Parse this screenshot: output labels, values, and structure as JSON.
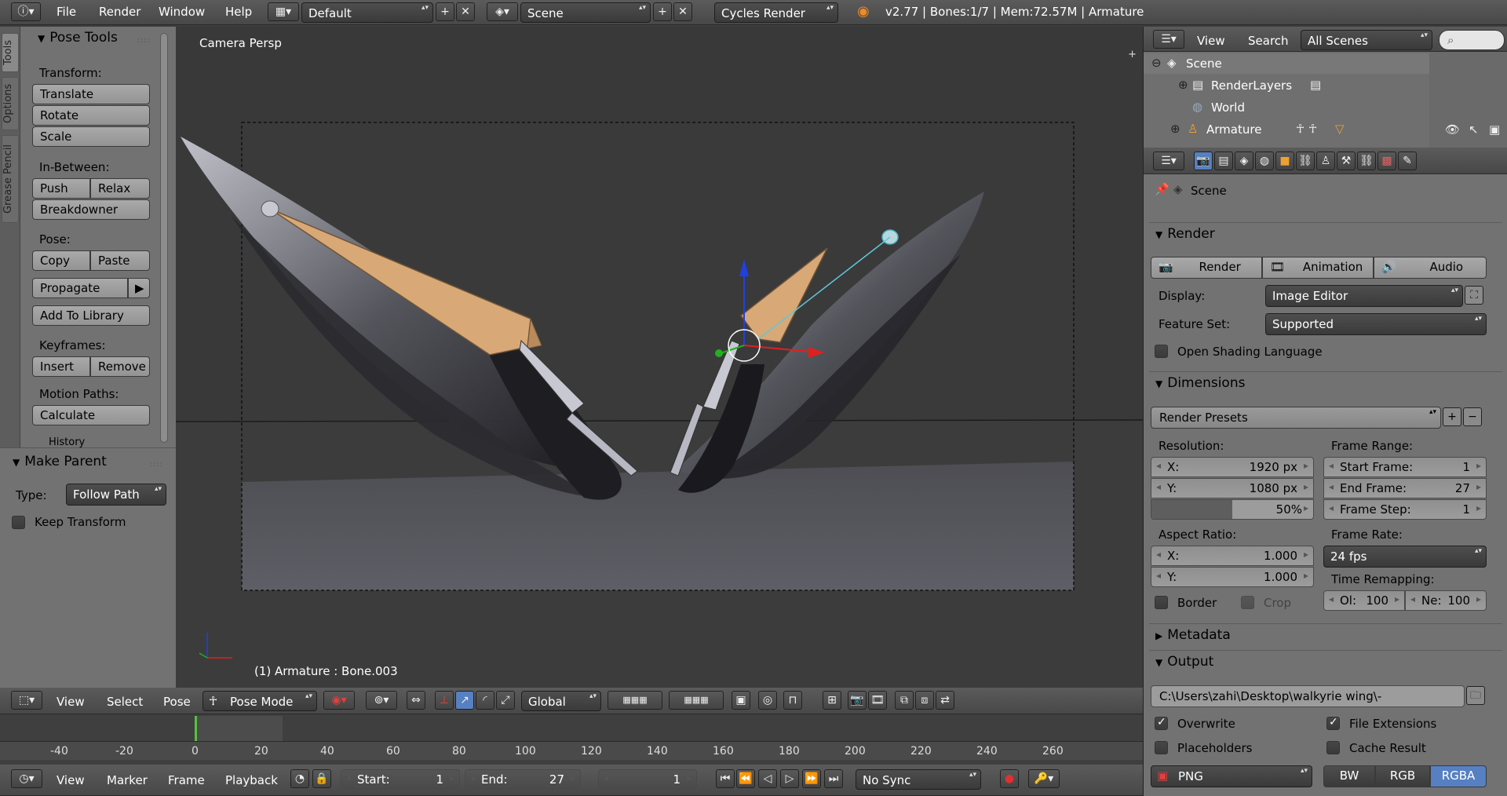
{
  "topbar": {
    "menus": [
      "File",
      "Render",
      "Window",
      "Help"
    ],
    "layout": "Default",
    "scene": "Scene",
    "engine": "Cycles Render",
    "status": "v2.77 | Bones:1/7 | Mem:72.57M | Armature"
  },
  "tabs": [
    "Tools",
    "Options",
    "Grease Pencil"
  ],
  "pose_tools": {
    "title": "Pose Tools",
    "transform_label": "Transform:",
    "translate": "Translate",
    "rotate": "Rotate",
    "scale": "Scale",
    "inbetween_label": "In-Between:",
    "push": "Push",
    "relax": "Relax",
    "breakdowner": "Breakdowner",
    "pose_label": "Pose:",
    "copy": "Copy",
    "paste": "Paste",
    "propagate": "Propagate",
    "add_to_library": "Add To Library",
    "keyframes_label": "Keyframes:",
    "insert": "Insert",
    "remove": "Remove",
    "motion_label": "Motion Paths:",
    "calculate": "Calculate",
    "history": "History"
  },
  "make_parent": {
    "title": "Make Parent",
    "type_label": "Type:",
    "type_value": "Follow Path",
    "keep_transform": "Keep Transform"
  },
  "viewport": {
    "title": "Camera Persp",
    "info": "(1) Armature : Bone.003"
  },
  "view_header": {
    "menus": [
      "View",
      "Select",
      "Pose"
    ],
    "mode": "Pose Mode",
    "orientation": "Global"
  },
  "timeline": {
    "ticks": [
      "-40",
      "-20",
      "0",
      "20",
      "40",
      "60",
      "80",
      "100",
      "120",
      "140",
      "160",
      "180",
      "200",
      "220",
      "240",
      "260"
    ],
    "menus": [
      "View",
      "Marker",
      "Frame",
      "Playback"
    ],
    "start_label": "Start:",
    "start_value": "1",
    "end_label": "End:",
    "end_value": "27",
    "current": "1",
    "sync": "No Sync"
  },
  "outliner": {
    "menus": [
      "View",
      "Search"
    ],
    "filter": "All Scenes",
    "items": [
      "Scene",
      "RenderLayers",
      "World",
      "Armature"
    ]
  },
  "properties": {
    "context": "Scene",
    "render_section": "Render",
    "render_btn": "Render",
    "animation_btn": "Animation",
    "audio_btn": "Audio",
    "display_label": "Display:",
    "display_value": "Image Editor",
    "feature_label": "Feature Set:",
    "feature_value": "Supported",
    "osl": "Open Shading Language",
    "dimensions": "Dimensions",
    "render_presets": "Render Presets",
    "resolution_label": "Resolution:",
    "res_x_label": "X:",
    "res_x": "1920 px",
    "res_y_label": "Y:",
    "res_y": "1080 px",
    "res_pct": "50%",
    "res_pct_value": 0.5,
    "frame_range_label": "Frame Range:",
    "start_frame_label": "Start Frame:",
    "start_frame": "1",
    "end_frame_label": "End Frame:",
    "end_frame": "27",
    "frame_step_label": "Frame Step:",
    "frame_step": "1",
    "aspect_label": "Aspect Ratio:",
    "aspect_x_label": "X:",
    "aspect_x": "1.000",
    "aspect_y_label": "Y:",
    "aspect_y": "1.000",
    "frame_rate_label": "Frame Rate:",
    "frame_rate": "24 fps",
    "time_remap_label": "Time Remapping:",
    "old_label": "Ol:",
    "old": "100",
    "new_label": "Ne:",
    "new": "100",
    "border": "Border",
    "crop": "Crop",
    "metadata": "Metadata",
    "output": "Output",
    "output_path": "C:\\Users\\zahi\\Desktop\\walkyrie wing\\-",
    "overwrite": "Overwrite",
    "file_extensions": "File Extensions",
    "placeholders": "Placeholders",
    "cache_result": "Cache Result",
    "format": "PNG",
    "bw": "BW",
    "rgb": "RGB",
    "rgba": "RGBA"
  },
  "colors": {
    "bone": "#d9a877",
    "x_axis": "#e02020",
    "y_axis": "#20b020",
    "z_axis": "#2040e0",
    "accent": "#5680c2"
  }
}
